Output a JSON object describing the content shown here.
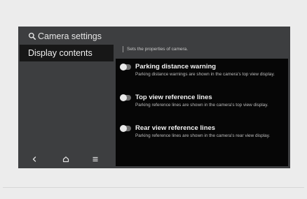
{
  "screen": {
    "title": "Camera settings",
    "title_icon": "search-icon",
    "sidebar": {
      "items": [
        {
          "label": "Display contents",
          "selected": true
        }
      ]
    },
    "subtitle": "Sets the properties of camera.",
    "settings": [
      {
        "label": "Parking distance warning",
        "description": "Parking distance warnings are shown in the camera's top view display.",
        "enabled": false
      },
      {
        "label": "Top view reference lines",
        "description": "Parking reference lines are shown in the camera's top view display.",
        "enabled": false
      },
      {
        "label": "Rear view reference lines",
        "description": "Parking reference lines are shown in the camera's rear view display.",
        "enabled": false
      }
    ],
    "nav": {
      "back_icon": "back-icon",
      "home_icon": "home-icon",
      "menu_icon": "menu-icon"
    }
  },
  "colors": {
    "screen_bg": "#3d3e40",
    "panel_bg": "#060606",
    "sidebar_selected_bg": "#171717",
    "text_primary": "#f2f2f2",
    "text_secondary": "#bdbdbd",
    "toggle_off": "#6f6f6f"
  }
}
